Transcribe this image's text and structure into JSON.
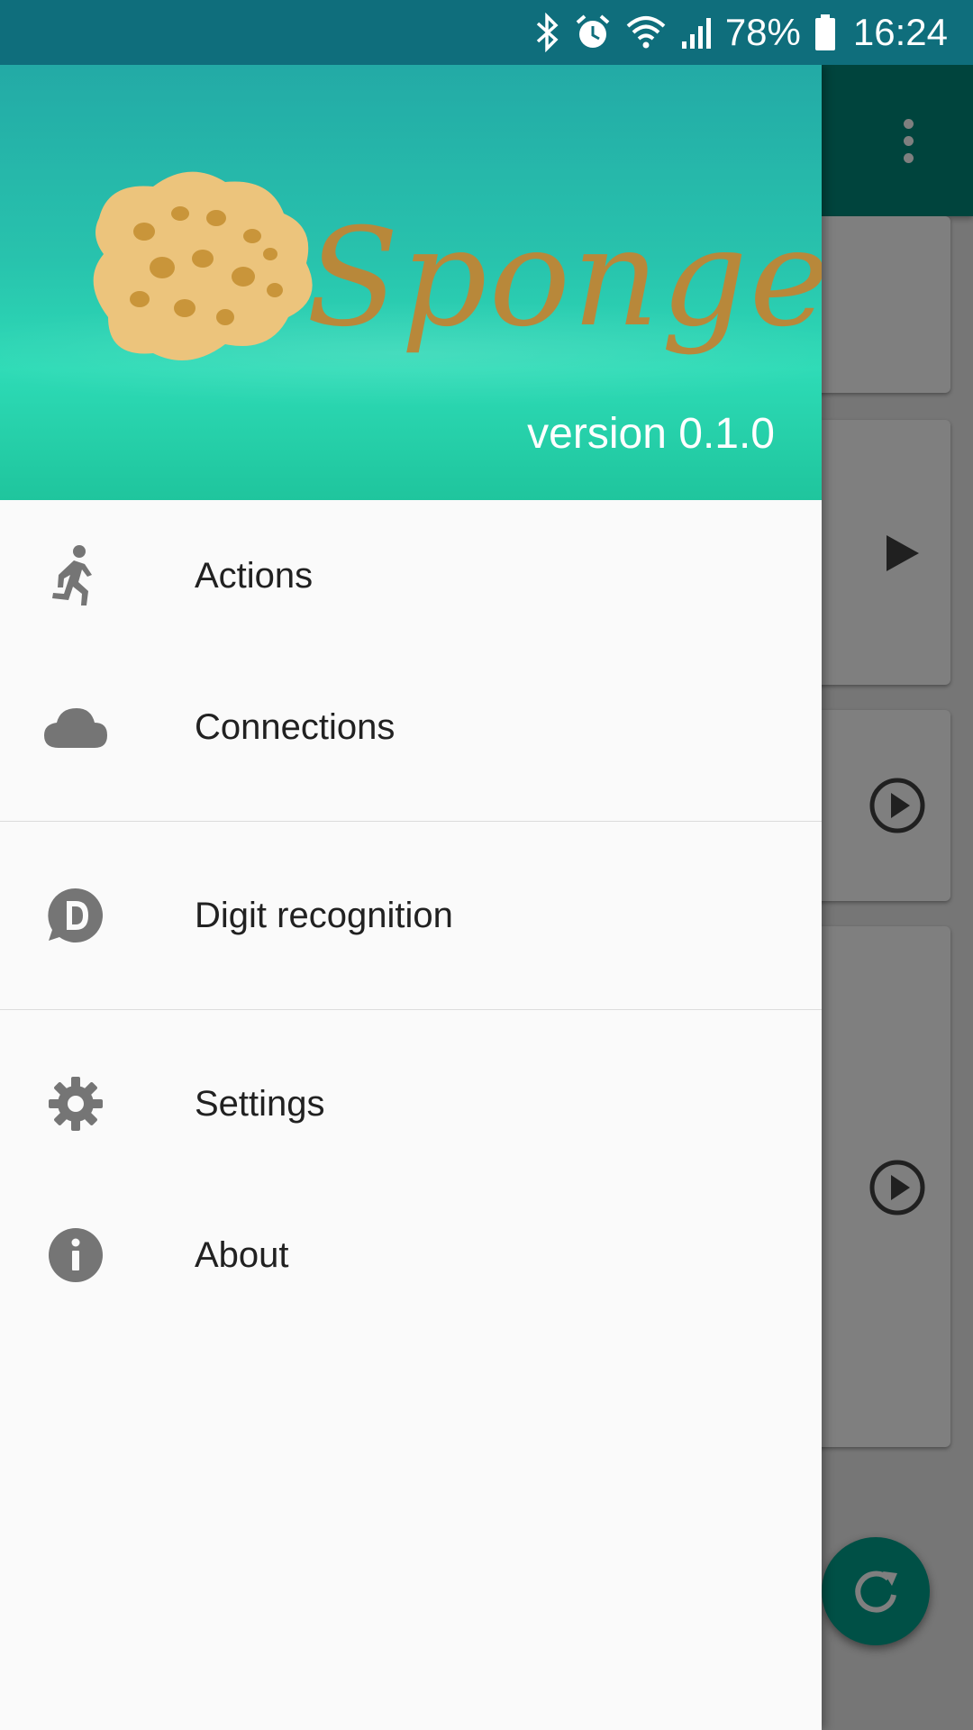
{
  "status_bar": {
    "battery_percent": "78%",
    "time": "16:24",
    "icons": [
      "bluetooth-icon",
      "alarm-icon",
      "wifi-icon",
      "signal-icon",
      "battery-icon"
    ]
  },
  "drawer": {
    "header": {
      "logo_text": "Sponge",
      "version": "version 0.1.0"
    },
    "groups": [
      {
        "items": [
          {
            "label": "Actions",
            "icon": "run-icon"
          },
          {
            "label": "Connections",
            "icon": "cloud-icon"
          }
        ]
      },
      {
        "items": [
          {
            "label": "Digit recognition",
            "icon": "digit-d-icon"
          }
        ]
      },
      {
        "items": [
          {
            "label": "Settings",
            "icon": "gear-icon"
          },
          {
            "label": "About",
            "icon": "info-icon"
          }
        ]
      }
    ]
  },
  "colors": {
    "toolbar": "#00897b",
    "status_bar": "#0f6e7c",
    "drawer_background": "#fafafa",
    "menu_text": "#212121",
    "menu_icon": "#757575",
    "logo": "#b8883a",
    "fab": "#00a08c"
  }
}
